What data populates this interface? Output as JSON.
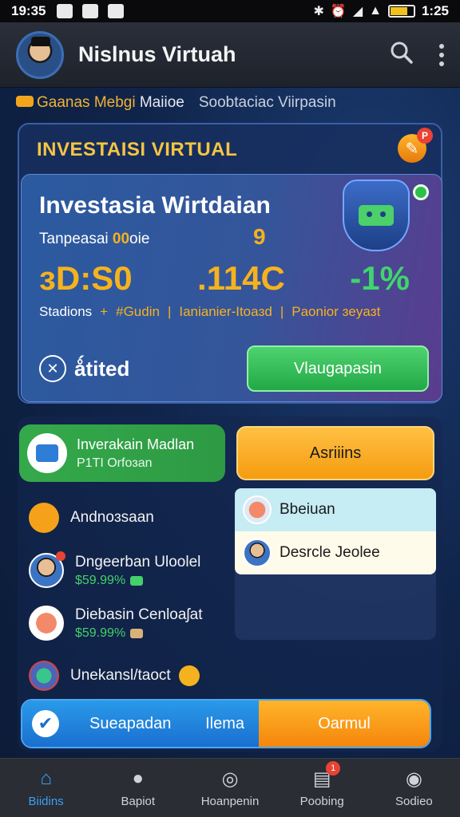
{
  "status_bar": {
    "time": "19:35",
    "battery_time": "1:25",
    "left_icons": [
      "photo-icon",
      "gallery-icon",
      "close-icon"
    ],
    "right_icons": [
      "bluetooth-icon",
      "alarm-icon",
      "wifi-icon",
      "signal-icon",
      "battery-icon"
    ]
  },
  "app_bar": {
    "title": "Nislnus Virtuah",
    "icons": [
      "search-icon",
      "more-vert-icon"
    ]
  },
  "subheader": {
    "item1_accent": "Gaanas Mebgi",
    "item1_plain": "Maiioe",
    "item2": "Soobtaciac Viirpasin"
  },
  "panel": {
    "title": "INVESTAISI VIRTUAL",
    "edit_badge": "P",
    "card": {
      "title": "Investasia Wirtdaian",
      "label_prefix": "Tanpeasai",
      "label_accent": "00",
      "label_suffix": "oie",
      "mark": "9",
      "stat1": "ɜD:S0",
      "stat2": ".114C",
      "stat3": "-1%",
      "row2": {
        "a": "Stadions",
        "plus": "+",
        "b": "#Gudin",
        "sep1": "|",
        "c": "Ianianier-Itoaɜd",
        "sep2": "|",
        "d": "Paonior ɜeyaɜt"
      },
      "status_text": "ǻtited",
      "action_label": "Vlaugapasin"
    }
  },
  "lower": {
    "invest_card": {
      "title": "Inverakain Madlan",
      "subtitle": "P1TI Orfoɜan"
    },
    "orange_button": "Asriiins",
    "list": [
      {
        "title": "Andnoɜsaan",
        "subtitle": ""
      },
      {
        "title": "Dngeerban Uloolel",
        "subtitle": "$59.99%"
      },
      {
        "title": "Diebasin Cenloaʃat",
        "subtitle": "$59.99%"
      },
      {
        "title": "Unekansl/taoct",
        "subtitle": ""
      }
    ],
    "right_list": [
      {
        "label": "Bbeiuan"
      },
      {
        "label": "Desrcle Jeolee"
      }
    ]
  },
  "bottom_cta": {
    "left_label": "Sueapadan",
    "middle_label": "Ilema",
    "right_label": "Oarmul"
  },
  "bottom_nav": [
    {
      "label": "Biidins",
      "icon": "home-icon",
      "active": true
    },
    {
      "label": "Bapiot",
      "icon": "person-icon",
      "active": false
    },
    {
      "label": "Hoanpenin",
      "icon": "compass-icon",
      "active": false
    },
    {
      "label": "Poobing",
      "icon": "chart-icon",
      "active": false,
      "badge": "1"
    },
    {
      "label": "Sodieo",
      "icon": "profile-icon",
      "active": false
    }
  ]
}
